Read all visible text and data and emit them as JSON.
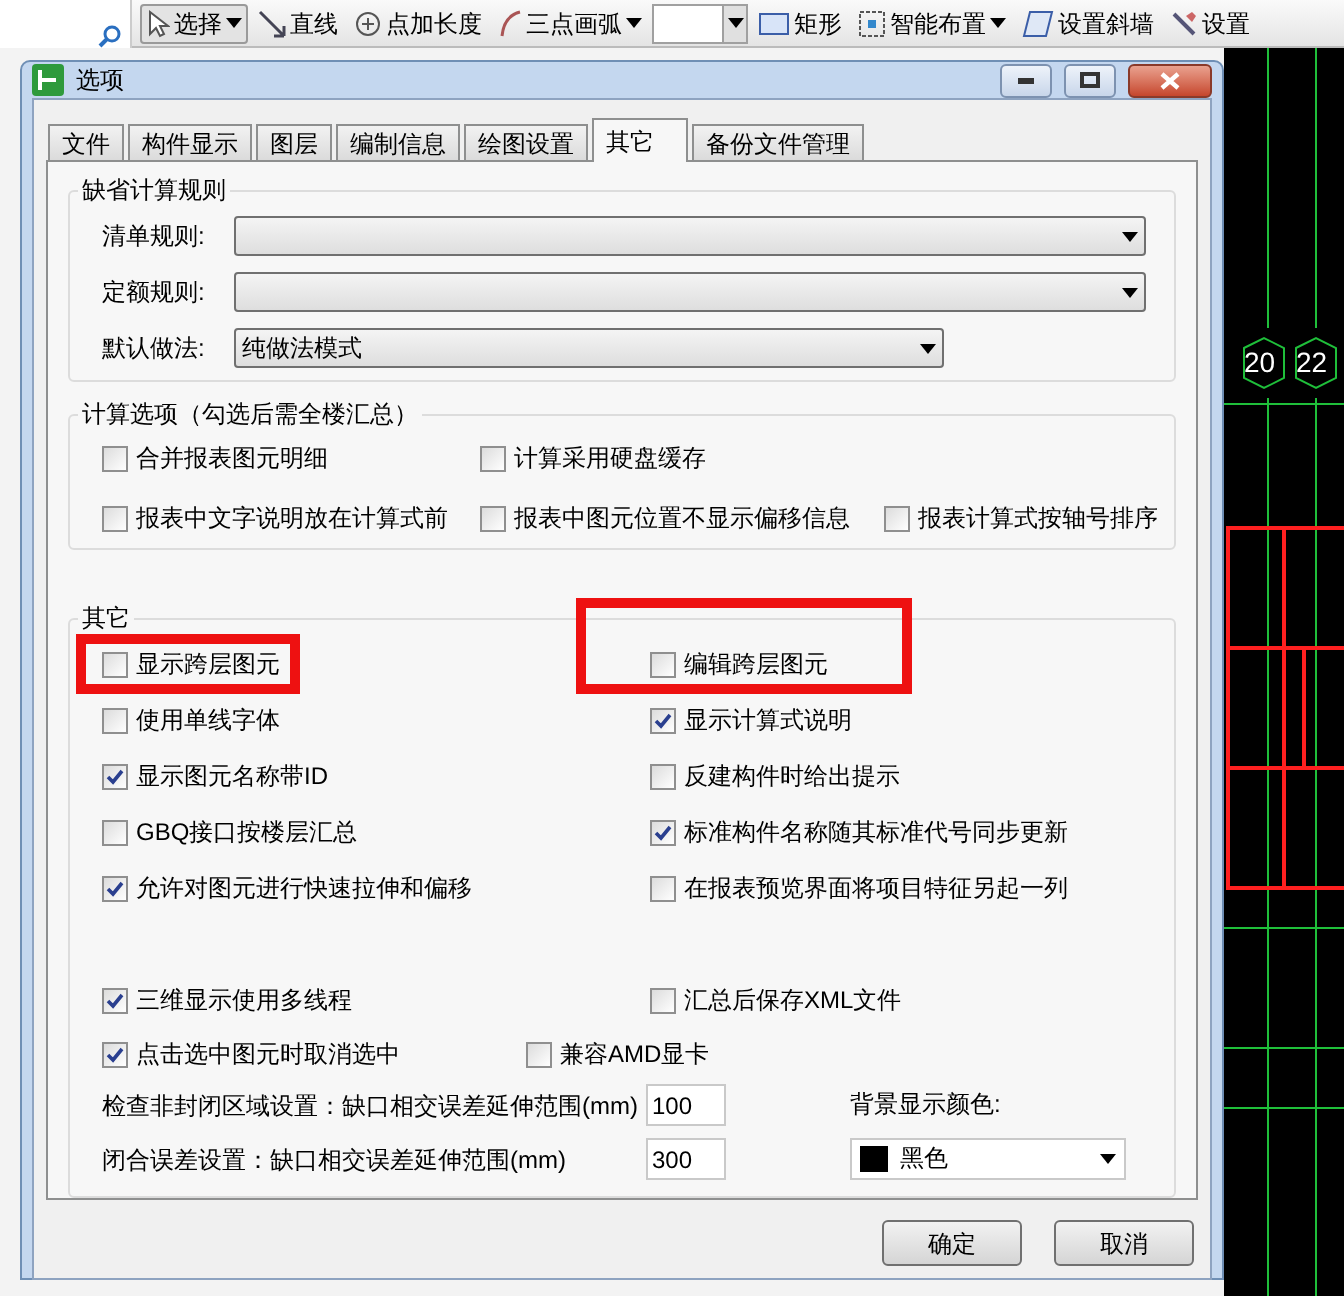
{
  "toolbar": {
    "items": [
      {
        "kind": "button",
        "label": "选择",
        "dropdown": true,
        "selected": true
      },
      {
        "kind": "button",
        "label": "直线",
        "dropdown": false,
        "selected": false
      },
      {
        "kind": "button",
        "label": "点加长度",
        "dropdown": false,
        "selected": false
      },
      {
        "kind": "button",
        "label": "三点画弧",
        "dropdown": true,
        "selected": false
      },
      {
        "kind": "combo"
      },
      {
        "kind": "button",
        "label": "矩形",
        "dropdown": false,
        "selected": false
      },
      {
        "kind": "button",
        "label": "智能布置",
        "dropdown": true,
        "selected": false
      },
      {
        "kind": "button",
        "label": "设置斜墙",
        "dropdown": false,
        "selected": false
      },
      {
        "kind": "button",
        "label": "设置",
        "dropdown": false,
        "selected": false
      }
    ]
  },
  "canvas": {
    "labels": [
      "20",
      "22"
    ]
  },
  "dialog": {
    "title": "选项",
    "tabs": [
      {
        "label": "文件",
        "selected": false
      },
      {
        "label": "构件显示",
        "selected": false
      },
      {
        "label": "图层",
        "selected": false
      },
      {
        "label": "编制信息",
        "selected": false
      },
      {
        "label": "绘图设置",
        "selected": false
      },
      {
        "label": "其它",
        "selected": true
      },
      {
        "label": "备份文件管理",
        "selected": false
      }
    ],
    "default_rules": {
      "title": "缺省计算规则",
      "fields": [
        {
          "label": "清单规则:",
          "wide": true
        },
        {
          "label": "定额规则:",
          "wide": true
        },
        {
          "label": "默认做法:",
          "value": "纯做法模式",
          "wide": false
        }
      ]
    },
    "calc_options": {
      "title": "计算选项（勾选后需全楼汇总）",
      "rows": [
        [
          {
            "label": "合并报表图元明细",
            "checked": false
          },
          {
            "label": "计算采用硬盘缓存",
            "checked": false
          }
        ],
        [
          {
            "label": "报表中文字说明放在计算式前",
            "checked": false
          },
          {
            "label": "报表中图元位置不显示偏移信息",
            "checked": false
          },
          {
            "label": "报表计算式按轴号排序",
            "checked": false
          }
        ]
      ]
    },
    "other": {
      "title": "其它",
      "left": [
        {
          "label": "显示跨层图元",
          "checked": false
        },
        {
          "label": "使用单线字体",
          "checked": false
        },
        {
          "label": "显示图元名称带ID",
          "checked": true
        },
        {
          "label": "GBQ接口按楼层汇总",
          "checked": false
        },
        {
          "label": "允许对图元进行快速拉伸和偏移",
          "checked": true
        },
        {
          "label": "三维显示使用多线程",
          "checked": true
        }
      ],
      "right": [
        {
          "label": "编辑跨层图元",
          "checked": false
        },
        {
          "label": "显示计算式说明",
          "checked": true
        },
        {
          "label": "反建构件时给出提示",
          "checked": false
        },
        {
          "label": "标准构件名称随其标准代号同步更新",
          "checked": true
        },
        {
          "label": "在报表预览界面将项目特征另起一列",
          "checked": false
        },
        {
          "label": "汇总后保存XML文件",
          "checked": false
        }
      ],
      "bottom_row": [
        {
          "label": "点击选中图元时取消选中",
          "checked": true
        },
        {
          "label": "兼容AMD显卡",
          "checked": false
        }
      ],
      "ranges": [
        {
          "label": "检查非封闭区域设置：缺口相交误差延伸范围(mm)",
          "value": "100"
        },
        {
          "label": "闭合误差设置：缺口相交误差延伸范围(mm)",
          "value": "300"
        }
      ],
      "background": {
        "label": "背景显示颜色:",
        "value": "黑色",
        "color": "#000000"
      }
    },
    "buttons": [
      "确定",
      "取消"
    ]
  }
}
